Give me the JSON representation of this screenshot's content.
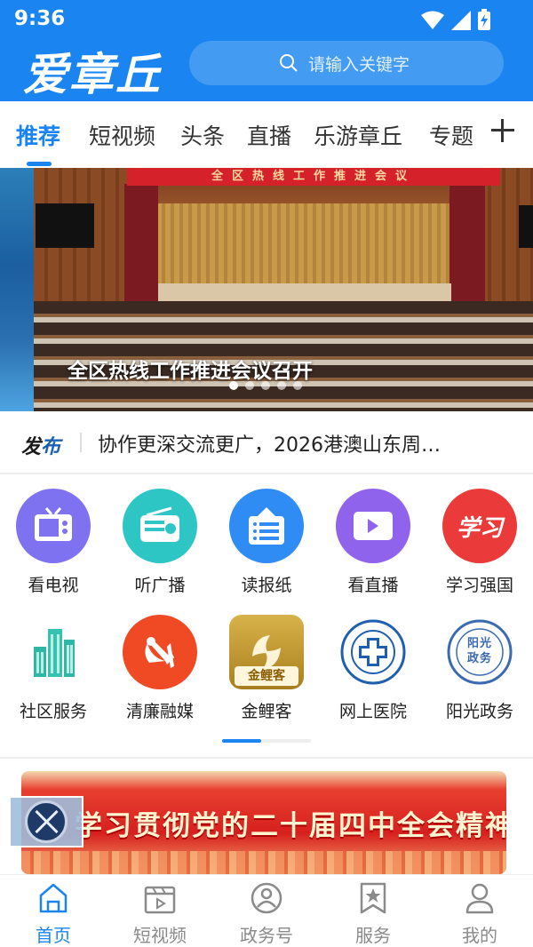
{
  "status_bar": {
    "time": "9:36"
  },
  "header": {
    "logo": "爱章丘",
    "search_placeholder": "请输入关键字"
  },
  "tabs": [
    {
      "label": "推荐",
      "active": true
    },
    {
      "label": "短视频",
      "active": false
    },
    {
      "label": "头条",
      "active": false
    },
    {
      "label": "直播",
      "active": false
    },
    {
      "label": "乐游章丘",
      "active": false
    },
    {
      "label": "专题",
      "active": false
    }
  ],
  "banner": {
    "hall_text": "全区热线工作推进会议",
    "caption": "全区热线工作推进会议召开",
    "slide_count": 5,
    "active_slide": 1
  },
  "ticker": {
    "tag_prefix": "发",
    "tag_suffix": "布",
    "text": "协作更深交流更广，2026港澳山东周…"
  },
  "services": [
    {
      "label": "看电视",
      "icon": "tv-icon",
      "color": "#7f72f0"
    },
    {
      "label": "听广播",
      "icon": "radio-icon",
      "color": "#2ec5c5"
    },
    {
      "label": "读报纸",
      "icon": "newspaper-icon",
      "color": "#2f8cf5"
    },
    {
      "label": "看直播",
      "icon": "video-camera-icon",
      "color": "#8f63ec"
    },
    {
      "label": "学习强国",
      "icon": "xuexi-icon",
      "color": "#ea3a3a"
    },
    {
      "label": "社区服务",
      "icon": "community-building-icon",
      "color": "#2db7a5"
    },
    {
      "label": "清廉融媒",
      "icon": "party-emblem-icon",
      "color": "#f04a24"
    },
    {
      "label": "金鲤客",
      "icon": "golden-carp-icon",
      "color": "#c9a030",
      "badge": "金鲤客"
    },
    {
      "label": "网上医院",
      "icon": "hospital-seal-icon",
      "color": "#1f5fb0"
    },
    {
      "label": "阳光政务",
      "icon": "government-seal-icon",
      "color": "#3a6ab0",
      "seal_text": "阳光政务"
    }
  ],
  "promo": {
    "text": "学习贯彻党的二十届四中全会精神"
  },
  "bottom_nav": [
    {
      "label": "首页",
      "icon": "home-icon",
      "active": true
    },
    {
      "label": "短视频",
      "icon": "clapperboard-icon",
      "active": false
    },
    {
      "label": "政务号",
      "icon": "government-account-icon",
      "active": false
    },
    {
      "label": "服务",
      "icon": "bookmark-star-icon",
      "active": false
    },
    {
      "label": "我的",
      "icon": "user-icon",
      "active": false
    }
  ],
  "colors": {
    "brand": "#1a85f0",
    "tab_active": "#1a85f0",
    "nav_inactive": "#8a8a8a"
  }
}
